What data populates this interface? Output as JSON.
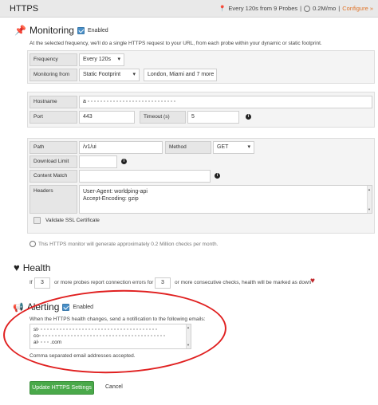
{
  "header": {
    "title": "HTTPS",
    "frequency_summary": "Every 120s from 9 Probes",
    "cost_summary": "0.2M/mo",
    "configure_link": "Configure »"
  },
  "monitoring": {
    "title": "Monitoring",
    "enabled_label": "Enabled",
    "description": "At the selected frequency, we'll do a single HTTPS request to your URL, from each probe within your dynamic or static footprint.",
    "frequency_label": "Frequency",
    "frequency_value": "Every 120s",
    "monitoring_from_label": "Monitoring from",
    "monitoring_from_value": "Static Footprint",
    "locations_value": "London, Miami and 7 more",
    "hostname_label": "Hostname",
    "hostname_value": "a",
    "port_label": "Port",
    "port_value": "443",
    "timeout_label": "Timeout (s)",
    "timeout_value": "5",
    "path_label": "Path",
    "path_value": "/v1/ui",
    "method_label": "Method",
    "method_value": "GET",
    "download_limit_label": "Download Limit",
    "download_limit_value": "",
    "content_match_label": "Content Match",
    "content_match_value": "",
    "headers_label": "Headers",
    "headers_line1": "User-Agent: worldping-api",
    "headers_line2": "Accept-Encoding: gzip",
    "validate_ssl_label": "Validate SSL Certificate",
    "checks_note": "This HTTPS monitor will generate approximately 0.2 Million checks per month."
  },
  "health": {
    "title": "Health",
    "if_text": "If",
    "probes_value": "3",
    "middle_text": "or more probes report connection errors for",
    "checks_value": "3",
    "end_text": "or more consecutive checks, health will be marked as down"
  },
  "alerting": {
    "title": "Alerting",
    "enabled_label": "Enabled",
    "description": "When the HTTPS health changes, send a notification to the following emails:",
    "emails_line1": "st",
    "emails_line2": "co",
    "emails_line3": "al",
    "emails_line3_tail": ".com",
    "emails_note": "Comma separated email addresses accepted."
  },
  "actions": {
    "update_label": "Update HTTPS Settings",
    "cancel_label": "Cancel"
  },
  "colors": {
    "accent": "#4a90c8",
    "primary_button": "#4aa94a",
    "link": "#e0752a",
    "annotation": "#e02020"
  }
}
